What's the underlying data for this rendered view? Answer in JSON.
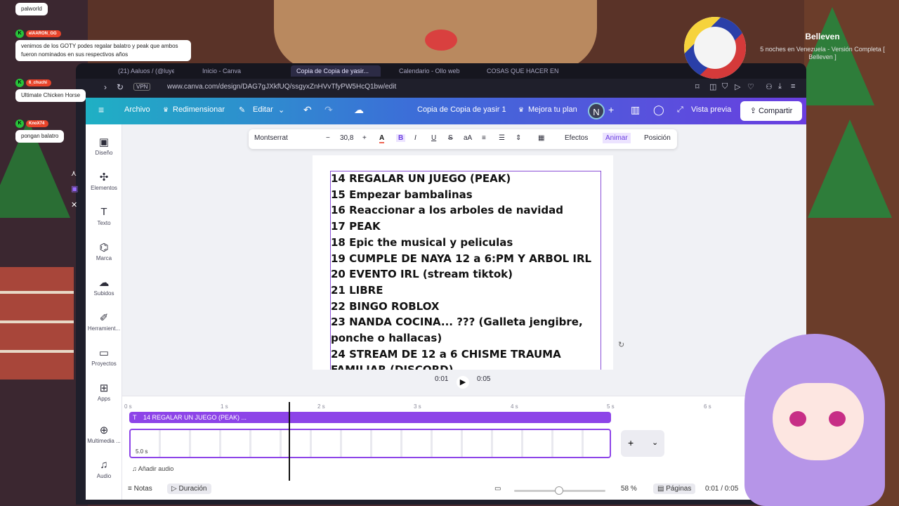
{
  "chat": {
    "messages": [
      {
        "user": "",
        "text": "palworld"
      },
      {
        "user": "elAARON_GG",
        "text": "venimos de los GOTY podes regalar balatro y peak que ambos fueron nominados en sus respectivos años"
      },
      {
        "user": "6_chuchi",
        "text": "Ultimate Chicken Horse"
      },
      {
        "user": "KnoX74",
        "text": "pongan balatro"
      }
    ]
  },
  "now_playing": {
    "title": "Belleven",
    "subtitle": "5 noches en Venezuela - Versión Completa [ Belleven ]"
  },
  "browser": {
    "tabs": [
      "(21) Aaluos / (@luyevu",
      "Inicio - Canva",
      "Copia de Copia de yasir...",
      "Calendario - Ollo web",
      "COSAS QUE HACER EN"
    ],
    "vpn": "VPN",
    "url": "www.canva.com/design/DAG7gJXkfUQ/ssgyxZnHVvTfyPW5HcQ1bw/edit"
  },
  "topbar": {
    "archivo": "Archivo",
    "redimensionar": "Redimensionar",
    "editar": "Editar",
    "doc_title": "Copia de Copia de yasir 1",
    "upgrade": "Mejora tu plan",
    "avatar": "N",
    "preview": "Vista previa",
    "share": "Compartir"
  },
  "sidebar": [
    {
      "label": "Diseño",
      "icon": "design-icon"
    },
    {
      "label": "Elementos",
      "icon": "elements-icon"
    },
    {
      "label": "Texto",
      "icon": "text-icon"
    },
    {
      "label": "Marca",
      "icon": "brand-icon"
    },
    {
      "label": "Subidos",
      "icon": "upload-icon"
    },
    {
      "label": "Herramient...",
      "icon": "tools-icon"
    },
    {
      "label": "Proyectos",
      "icon": "folder-icon"
    },
    {
      "label": "Apps",
      "icon": "apps-icon"
    },
    {
      "label": "Multimedia ...",
      "icon": "media-icon"
    },
    {
      "label": "Audio",
      "icon": "audio-icon"
    }
  ],
  "text_toolbar": {
    "font": "Montserrat",
    "size": "30,8",
    "effects": "Efectos",
    "animate": "Animar",
    "position": "Posición"
  },
  "canvas": {
    "lines": [
      "14 REGALAR UN JUEGO (PEAK)",
      "15 Empezar bambalinas",
      "16 Reaccionar a los arboles de navidad",
      "17 PEAK",
      "18 Epic the musical y peliculas",
      "19 CUMPLE DE NAYA 12 a 6:PM Y ARBOL IRL",
      "20 EVENTO IRL (stream tiktok)",
      "21 LIBRE",
      "22 BINGO ROBLOX",
      "23 NANDA COCINA... ??? (Galleta jengibre,",
      "ponche o hallacas)",
      "24 STREAM DE 12  a 6 CHISME TRAUMA",
      "FAMILIAR (DISCORD)"
    ]
  },
  "playback": {
    "current": "0:01",
    "total": "0:05"
  },
  "timeline": {
    "ticks": [
      "0 s",
      "1 s",
      "2 s",
      "3 s",
      "4 s",
      "5 s",
      "6 s"
    ],
    "track_label": "14 REGALAR UN JUEGO (PEAK) ...",
    "duration": "5.0 s",
    "add_audio": "Añadir audio",
    "playhead_seconds": 1.7
  },
  "footer": {
    "notes": "Notas",
    "duration": "Duración",
    "zoom": "58 %",
    "pages": "Páginas",
    "time": "0:01 / 0:05"
  },
  "colors": {
    "accent": "#8d44e8",
    "topbar_start": "#1fb0c4",
    "topbar_end": "#6a3ee0"
  }
}
